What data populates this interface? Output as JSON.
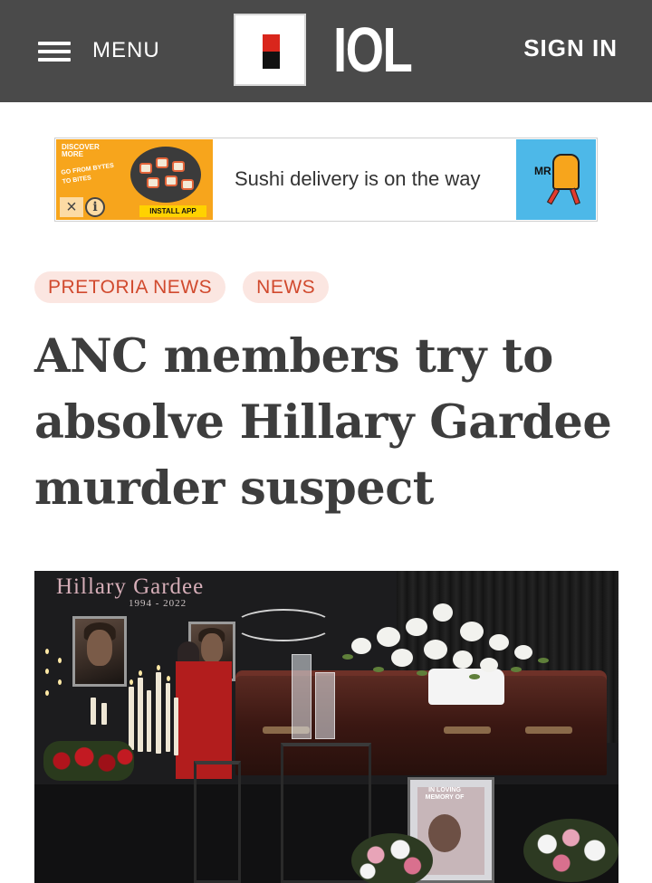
{
  "header": {
    "menu_label": "MENU",
    "logo_text": "IOL",
    "signin_label": "SIGN IN",
    "background_color": "#4a4a4a"
  },
  "ad": {
    "brand": "DISCOVER MORE",
    "slogan": "GO FROM BYTES TO BITES",
    "install_label": "INSTALL APP",
    "headline": "Sushi delivery is on the way",
    "advertiser_badge": "MR",
    "close_icon": "close-icon",
    "info_icon": "info-icon"
  },
  "article": {
    "tags": [
      "PRETORIA NEWS",
      "NEWS"
    ],
    "headline": "ANC members try to absolve Hillary Gardee murder suspect",
    "tag_color": "#d14a2e",
    "tag_background": "#fbe6e1"
  },
  "photo": {
    "banner_title": "Hillary Gardee",
    "banner_years": "1994 - 2022",
    "frame_caption": "IN LOVING MEMORY OF"
  }
}
